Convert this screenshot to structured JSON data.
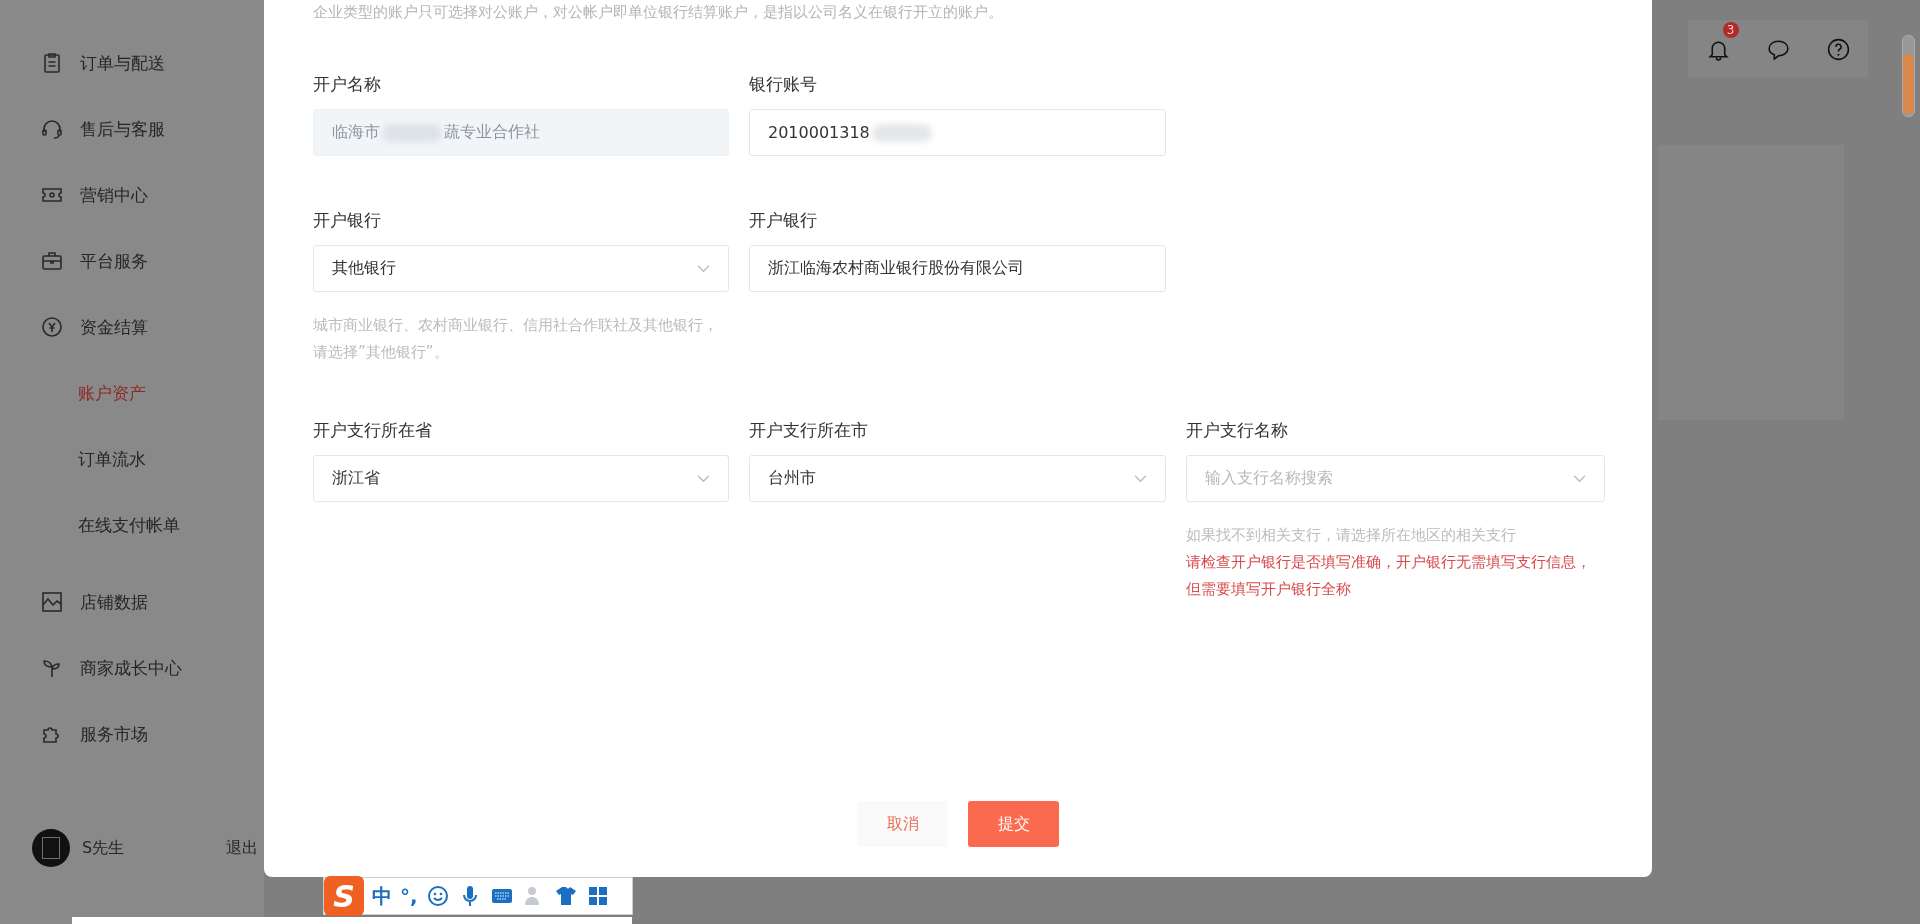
{
  "sidebar": {
    "items": [
      {
        "label": "订单与配送",
        "selected": false
      },
      {
        "label": "售后与客服",
        "selected": false
      },
      {
        "label": "营销中心",
        "selected": false
      },
      {
        "label": "平台服务",
        "selected": false
      },
      {
        "label": "资金结算",
        "selected": false,
        "children": [
          {
            "label": "账户资产",
            "selected": true
          },
          {
            "label": "订单流水",
            "selected": false
          },
          {
            "label": "在线支付帐单",
            "selected": false
          }
        ]
      },
      {
        "label": "店铺数据",
        "selected": false
      },
      {
        "label": "商家成长中心",
        "selected": false
      },
      {
        "label": "服务市场",
        "selected": false
      }
    ],
    "user": {
      "name": "S先生",
      "logout": "退出"
    }
  },
  "header": {
    "notification_count": "3"
  },
  "dialog": {
    "intro": "企业类型的账户只可选择对公账户，对公帐户即单位银行结算账户，是指以公司名义在银行开立的账户。",
    "rows": [
      [
        {
          "label": "开户名称",
          "kind": "input",
          "value": "临海市",
          "value_tail": "蔬专业合作社",
          "disabled": true
        },
        {
          "label": "银行账号",
          "kind": "input",
          "value": "2010001318",
          "disabled": false
        }
      ],
      [
        {
          "label": "开户银行",
          "kind": "select",
          "value": "其他银行",
          "disabled": false,
          "hint": "城市商业银行、农村商业银行、信用社合作联社及其他银行，请选择”其他银行”。"
        },
        {
          "label": "开户银行",
          "kind": "input",
          "value": "浙江临海农村商业银行股份有限公司",
          "disabled": false
        }
      ],
      [
        {
          "label": "开户支行所在省",
          "kind": "select",
          "value": "浙江省",
          "disabled": false
        },
        {
          "label": "开户支行所在市",
          "kind": "select",
          "value": "台州市",
          "disabled": false
        },
        {
          "label": "开户支行名称",
          "kind": "select",
          "placeholder": "输入支行名称搜索",
          "disabled": false,
          "hint": "如果找不到相关支行，请选择所在地区的相关支行",
          "error": "请检查开户银行是否填写准确，开户银行无需填写支行信息，但需要填写开户银行全称"
        }
      ]
    ],
    "buttons": [
      {
        "label": "取消",
        "kind": "secondary"
      },
      {
        "label": "提交",
        "kind": "primary"
      }
    ]
  },
  "ime_toolbar": {
    "logo": "S",
    "mode": "中",
    "punctuation": "°,"
  }
}
